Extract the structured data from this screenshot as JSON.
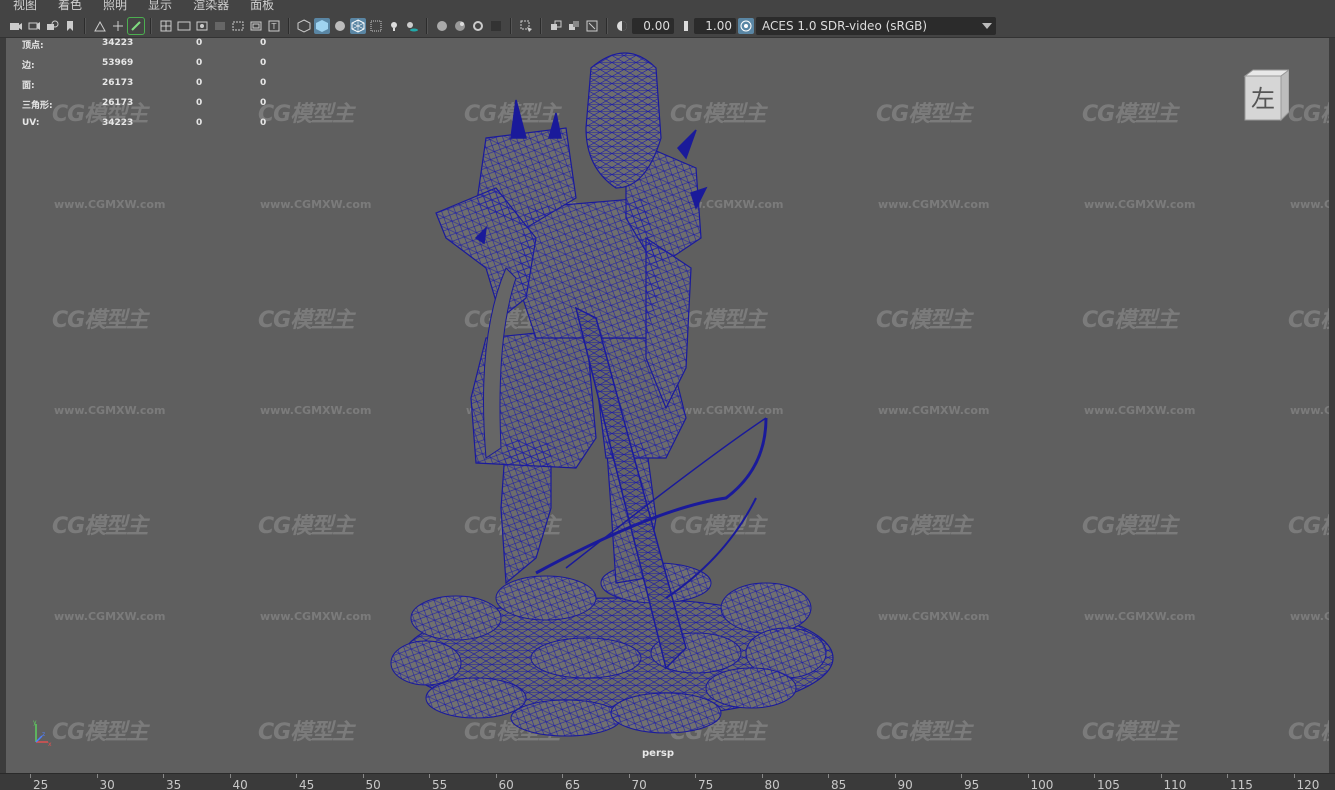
{
  "menu": [
    "视图",
    "着色",
    "照明",
    "显示",
    "渲染器",
    "面板"
  ],
  "toolbar": {
    "exposure_value": "0.00",
    "gamma_value": "1.00",
    "color_space": "ACES 1.0 SDR-video (sRGB)"
  },
  "hud": {
    "rows": [
      {
        "label": "顶点:",
        "total": "34223",
        "sel1": "0",
        "sel2": "0"
      },
      {
        "label": "边:",
        "total": "53969",
        "sel1": "0",
        "sel2": "0"
      },
      {
        "label": "面:",
        "total": "26173",
        "sel1": "0",
        "sel2": "0"
      },
      {
        "label": "三角形:",
        "total": "26173",
        "sel1": "0",
        "sel2": "0"
      },
      {
        "label": "UV:",
        "total": "34223",
        "sel1": "0",
        "sel2": "0"
      }
    ]
  },
  "viewport": {
    "camera_label": "persp",
    "viewcube_face": "左",
    "watermark_logo": "CG模型主",
    "watermark_url": "www.CGMXW.com"
  },
  "timeline": {
    "ticks": [
      "25",
      "30",
      "35",
      "40",
      "45",
      "50",
      "55",
      "60",
      "65",
      "70",
      "75",
      "80",
      "85",
      "90",
      "95",
      "100",
      "105",
      "110",
      "115",
      "120"
    ]
  },
  "colors": {
    "wireframe": "#1a1a9a",
    "viewport_bg": "#5f5f5f",
    "active_icon": "#5a86a4"
  },
  "icons": [
    "camera-icon",
    "select-camera-icon",
    "lock-camera-icon",
    "bookmark-icon",
    "image-plane-icon",
    "2d-pan-icon",
    "grease-pencil-icon",
    "grid-icon",
    "film-gate-icon",
    "resolution-gate-icon",
    "gate-mask-icon",
    "field-chart-icon",
    "safe-action-icon",
    "safe-title-icon",
    "wireframe-icon",
    "smooth-shade-icon",
    "default-material-icon",
    "wireframe-on-shaded-icon",
    "xray-icon",
    "use-lights-icon",
    "shadows-icon",
    "ambient-occlusion-icon",
    "motion-blur-icon",
    "anti-alias-icon",
    "depth-of-field-icon",
    "isolate-select-icon",
    "xray-joints-icon",
    "xray-active-icon",
    "exposure-icon",
    "gamma-icon",
    "color-management-icon"
  ]
}
